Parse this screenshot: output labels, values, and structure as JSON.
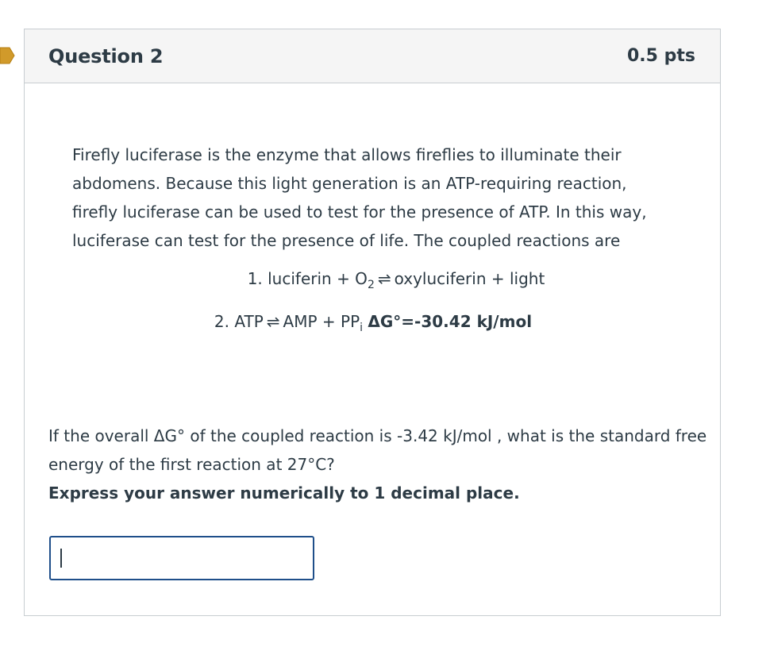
{
  "question": {
    "title": "Question 2",
    "points": "0.5 pts"
  },
  "intro_text": "Firefly luciferase is the enzyme that allows fireflies to illuminate their abdomens. Because this light generation is an ATP-requiring reaction, firefly luciferase can be used to test for the presence of ATP. In this way, luciferase can test for the presence of life. The coupled reactions are",
  "reactions": {
    "r1_prefix": "1. luciferin + O",
    "r1_sub": "2",
    "r1_suffix": "oxyluciferin + light",
    "r2_prefix": "2. ATP",
    "r2_mid": "AMP + PP",
    "r2_sub": "i",
    "r2_bold": "ΔG°=-30.42 kJ/mol",
    "arrow": "⇌"
  },
  "question_text": {
    "part1": "If the overall ΔG° of the coupled reaction is -3.42 kJ/mol , what is the standard free energy of the first reaction at 27°C?",
    "instruction": "Express your answer numerically to 1 decimal place."
  },
  "answer": {
    "value": ""
  },
  "colors": {
    "flag": "#d19a2a",
    "border": "#c7cdd1",
    "header_bg": "#f5f5f5",
    "input_border": "#1f4f8a",
    "text": "#2d3b45"
  }
}
